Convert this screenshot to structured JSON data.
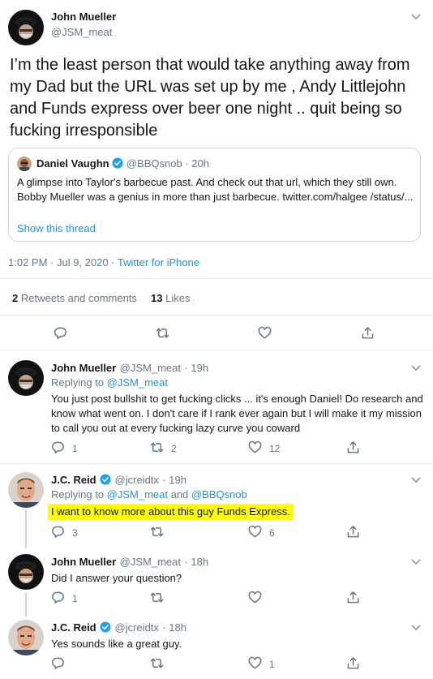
{
  "main_tweet": {
    "author_name": "John Mueller",
    "author_handle": "@JSM_meat",
    "text": "I’m the least person that would take anything away from my Dad but the URL was set up by me , Andy Littlejohn and Funds  express over beer one night .. quit being so fucking irresponsible",
    "quote": {
      "author_name": "Daniel Vaughn",
      "author_handle": "@BBQsnob",
      "time": "· 20h",
      "text": "A glimpse into Taylor's barbecue past. And check out that url, which they still own. Bobby Mueller was a genius in more than just barbecue. twitter.com/halgee /status/...",
      "show_thread": "Show this thread"
    },
    "timestamp": "1:02 PM · Jul 9, 2020 · ",
    "source": "Twitter for iPhone",
    "retweets_count": "2",
    "retweets_label": "Retweets and comments",
    "likes_count": "13",
    "likes_label": "Likes"
  },
  "replies": [
    {
      "author_name": "John Mueller",
      "author_handle": "@JSM_meat",
      "time": "· 19h",
      "replying_prefix": "Replying to ",
      "replying_to": "@JSM_meat",
      "replying_and": "",
      "replying_to_2": "",
      "text": "You just post bullshit to get fucking clicks ... it's enough Daniel! Do research and know what went on. I don't care if I rank ever again but I will make it my mission to call you out at every fucking lazy curve you coward",
      "reply_count": "1",
      "retweet_count": "2",
      "like_count": "12"
    },
    {
      "author_name": "J.C. Reid",
      "author_handle": "@jcreidtx",
      "time": "· 19h",
      "replying_prefix": "Replying to ",
      "replying_to": "@JSM_meat",
      "replying_and": " and ",
      "replying_to_2": "@BBQsnob",
      "text": "I want to know more about this guy Funds Express.",
      "reply_count": "3",
      "retweet_count": "",
      "like_count": "6"
    },
    {
      "author_name": "John Mueller",
      "author_handle": "@JSM_meat",
      "time": "· 18h",
      "text": "Did I answer your question?",
      "reply_count": "1",
      "retweet_count": "",
      "like_count": ""
    },
    {
      "author_name": "J.C. Reid",
      "author_handle": "@jcreidtx",
      "time": "· 18h",
      "text": "Yes sounds like a great guy.",
      "reply_count": "",
      "retweet_count": "",
      "like_count": "1"
    }
  ],
  "colors": {
    "link": "#1b95e0",
    "muted": "#657786",
    "divider": "#e6ecf0",
    "highlight": "#ffff00",
    "verified": "#1da1f2"
  },
  "icons": [
    "chevron-down-icon",
    "verified-icon",
    "reply-icon",
    "retweet-icon",
    "like-icon",
    "share-icon"
  ]
}
